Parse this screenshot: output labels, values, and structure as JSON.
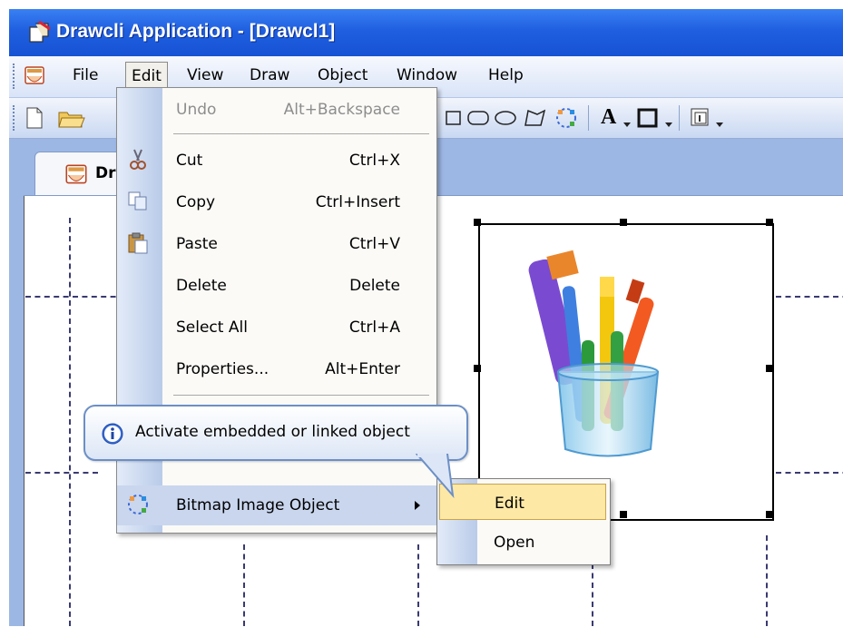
{
  "window": {
    "title": "Drawcli Application - [Drawcl1]"
  },
  "menubar": {
    "items": [
      {
        "label": "File"
      },
      {
        "label": "Edit"
      },
      {
        "label": "View"
      },
      {
        "label": "Draw"
      },
      {
        "label": "Object"
      },
      {
        "label": "Window"
      },
      {
        "label": "Help"
      }
    ]
  },
  "toolbar": {
    "text_tool_label": "A"
  },
  "doc_tab": {
    "label": "Dra"
  },
  "edit_menu": {
    "items": [
      {
        "label": "Undo",
        "shortcut": "Alt+Backspace",
        "enabled": false
      },
      {
        "label": "Cut",
        "shortcut": "Ctrl+X",
        "icon": "cut-icon"
      },
      {
        "label": "Copy",
        "shortcut": "Ctrl+Insert",
        "icon": "copy-icon"
      },
      {
        "label": "Paste",
        "shortcut": "Ctrl+V",
        "icon": "paste-icon"
      },
      {
        "label": "Delete",
        "shortcut": "Delete"
      },
      {
        "label": "Select All",
        "shortcut": "Ctrl+A"
      },
      {
        "label": "Properties...",
        "shortcut": "Alt+Enter"
      },
      {
        "label": "Bitmap Image Object",
        "icon": "ole-object-icon",
        "submenu": true
      }
    ]
  },
  "submenu": {
    "items": [
      {
        "label": "Edit",
        "highlighted": true
      },
      {
        "label": "Open"
      }
    ]
  },
  "tooltip": {
    "text": "Activate embedded or linked object",
    "icon": "info-icon"
  },
  "colors": {
    "titlebar": "#1f5fe0",
    "menu_gutter": "#b9cbe9",
    "menu_highlight": "#c9d6ee",
    "submenu_highlight": "#fde8a6"
  }
}
